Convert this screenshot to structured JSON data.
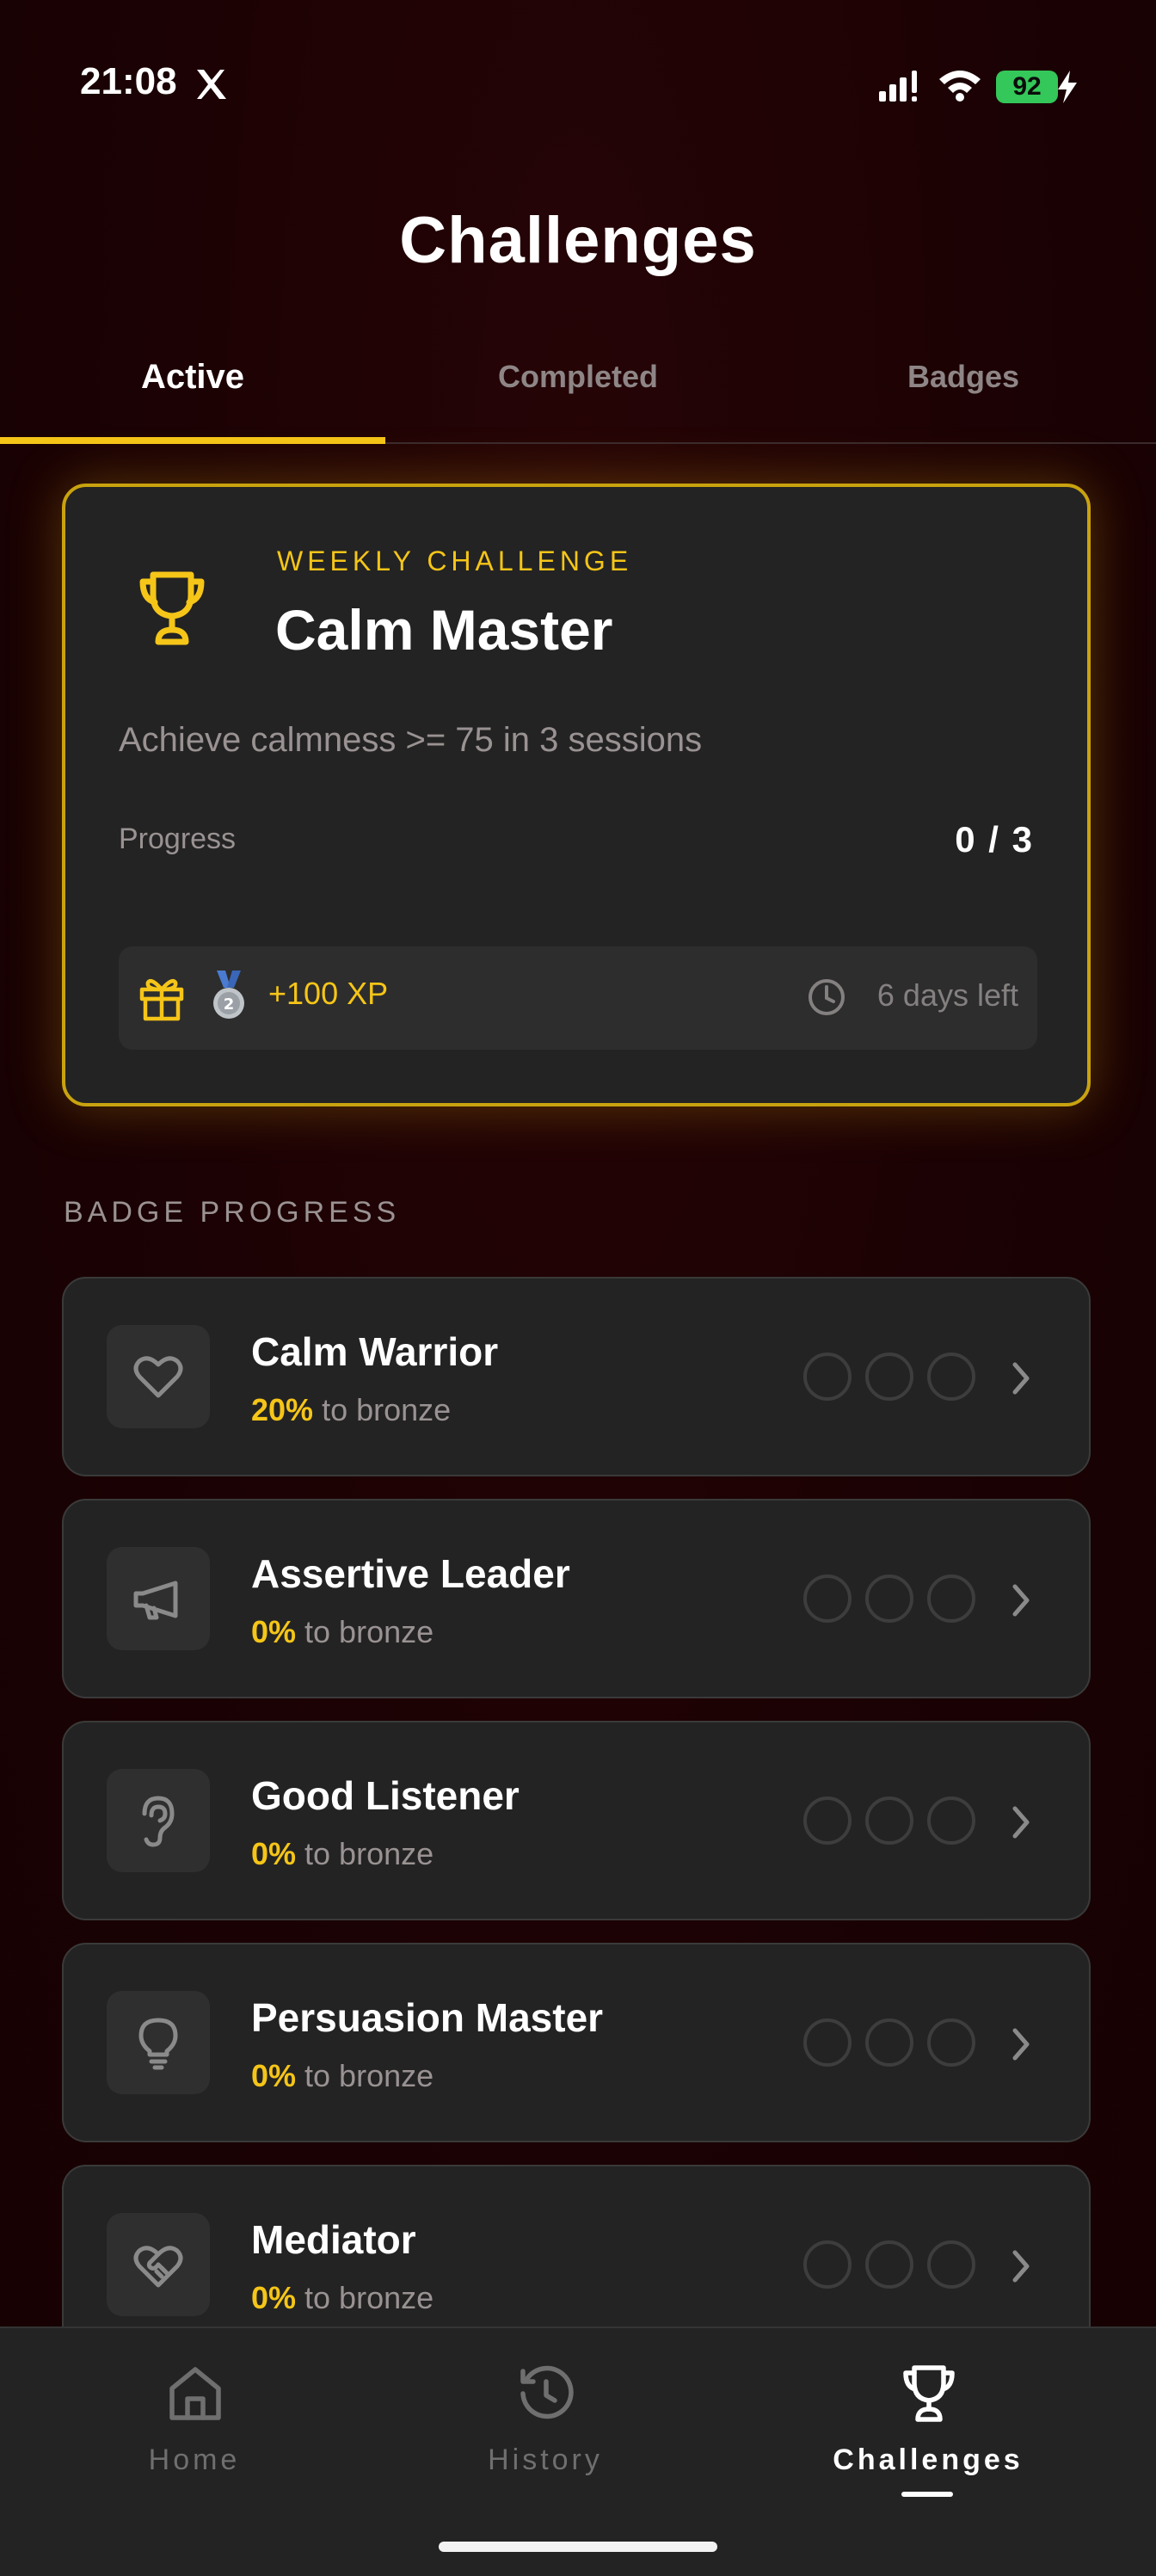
{
  "status_bar": {
    "time": "21:08",
    "app_icon": "x-logo",
    "battery": "92",
    "icons": [
      "signal-icon",
      "wifi-icon",
      "battery-icon",
      "charging-bolt-icon"
    ]
  },
  "header": {
    "title": "Challenges"
  },
  "tabs": [
    {
      "label": "Active",
      "active": true
    },
    {
      "label": "Completed",
      "active": false
    },
    {
      "label": "Badges",
      "active": false
    }
  ],
  "weekly_challenge": {
    "kicker": "WEEKLY CHALLENGE",
    "name": "Calm Master",
    "description": "Achieve calmness >= 75 in 3 sessions",
    "progress_label": "Progress",
    "progress_value": "0 / 3",
    "reward": "+100 XP",
    "time_left": "6 days left",
    "icons": [
      "trophy-icon",
      "gift-icon",
      "silver-medal-icon",
      "clock-icon"
    ]
  },
  "badge_progress": {
    "title": "BADGE PROGRESS",
    "items": [
      {
        "name": "Calm Warrior",
        "percent": "20%",
        "suffix": " to bronze",
        "icon": "heart-icon"
      },
      {
        "name": "Assertive Leader",
        "percent": "0%",
        "suffix": " to bronze",
        "icon": "megaphone-icon"
      },
      {
        "name": "Good Listener",
        "percent": "0%",
        "suffix": " to bronze",
        "icon": "ear-icon"
      },
      {
        "name": "Persuasion Master",
        "percent": "0%",
        "suffix": " to bronze",
        "icon": "lightbulb-icon"
      },
      {
        "name": "Mediator",
        "percent": "0%",
        "suffix": " to bronze",
        "icon": "heart-handshake-icon"
      }
    ]
  },
  "bottom_nav": {
    "items": [
      {
        "label": "Home",
        "icon": "home-icon",
        "active": false
      },
      {
        "label": "History",
        "icon": "history-icon",
        "active": false
      },
      {
        "label": "Challenges",
        "icon": "trophy-icon",
        "active": true
      }
    ]
  },
  "colors": {
    "accent": "#f5c518",
    "background": "#1a0304",
    "card": "#232323",
    "battery": "#34c759"
  }
}
